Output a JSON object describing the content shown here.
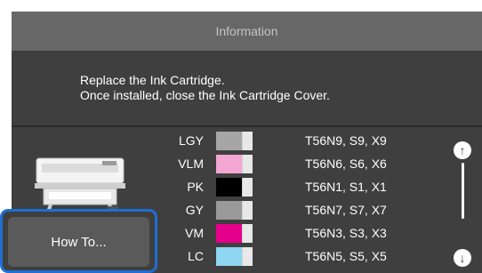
{
  "header": {
    "title": "Information"
  },
  "message": {
    "line1": "Replace the Ink Cartridge.",
    "line2": "Once installed, close the Ink Cartridge Cover."
  },
  "inks": [
    {
      "code": "LGY",
      "color": "#a6a6a6",
      "model": "T56N9, S9, X9"
    },
    {
      "code": "VLM",
      "color": "#f2a6d1",
      "model": "T56N6, S6, X6"
    },
    {
      "code": "PK",
      "color": "#000000",
      "model": "T56N1, S1, X1"
    },
    {
      "code": "GY",
      "color": "#9a9a9a",
      "model": "T56N7, S7, X7"
    },
    {
      "code": "VM",
      "color": "#e5008c",
      "model": "T56N3, S3, X3"
    },
    {
      "code": "LC",
      "color": "#8fd6f2",
      "model": "T56N5, S5, X5"
    }
  ],
  "buttons": {
    "how_to": "How To..."
  },
  "scroll": {
    "up_icon": "arrow-up-circle-icon",
    "down_icon": "arrow-down-circle-icon"
  },
  "colors": {
    "panel": "#3f3f3f",
    "title_bar": "#676767",
    "focus_ring": "#1f6ed4"
  }
}
